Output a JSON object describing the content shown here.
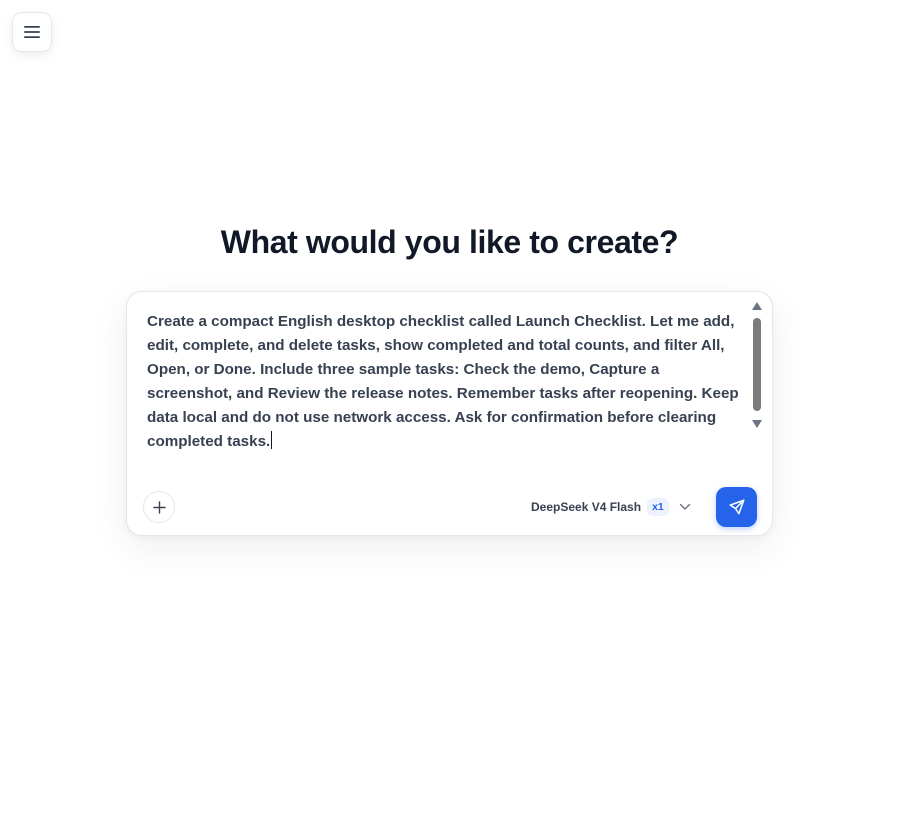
{
  "header": {
    "menu_icon": "hamburger-menu-icon"
  },
  "hero": {
    "title": "What would you like to create?"
  },
  "composer": {
    "prompt_value": "Create a compact English desktop checklist called Launch Checklist. Let me add, edit, complete, and delete tasks, show completed and total counts, and filter All, Open, or Done. Include three sample tasks: Check the demo, Capture a screenshot, and Review the release notes. Remember tasks after reopening. Keep data local and do not use network access. Ask for confirmation before clearing completed tasks.",
    "attach_icon": "plus-icon",
    "model": {
      "name": "DeepSeek V4 Flash",
      "badge": "x1",
      "chevron_icon": "chevron-down-icon"
    },
    "send_icon": "send-icon"
  },
  "colors": {
    "accent": "#2563eb",
    "title": "#111827",
    "text": "#374151",
    "border": "#e5e7eb"
  }
}
